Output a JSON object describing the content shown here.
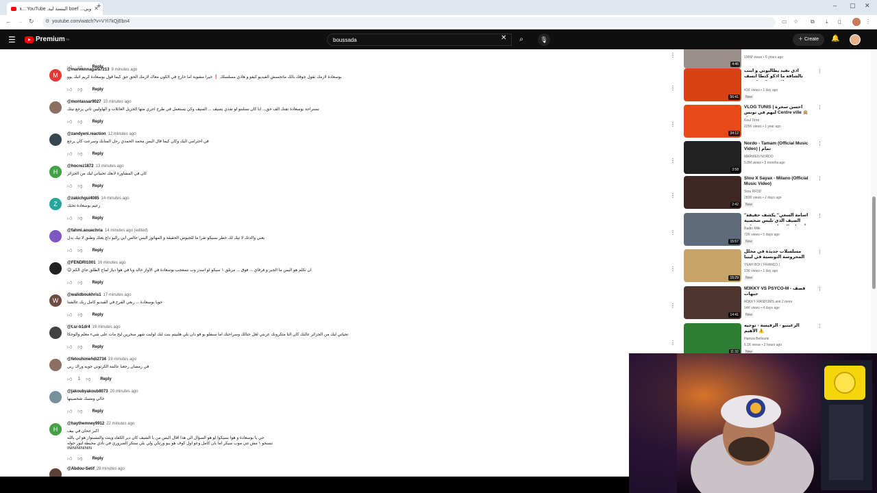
{
  "browser": {
    "tab_title": "وبي... boef البنسة ليه. ba... YouTube",
    "url": "youtube.com/watch?v=VYi7kQjEbn4",
    "new_tab": "+"
  },
  "header": {
    "logo_text": "Premium",
    "logo_tm": "TN",
    "search_value": "boussada",
    "create_label": "Create"
  },
  "comments": [
    {
      "user": "",
      "time": "",
      "text": "",
      "likes": "",
      "reply": "Reply",
      "avatar_letter": "",
      "avatar_color": "#ffffff"
    },
    {
      "user": "@marwennagara7213",
      "time": "9 minutes ago",
      "text": "بوسعادة لازمك تقول جوفك بالك ماتحسش الفيديو كيفو و هاذي مسلسلك ❗️ خيرا مشوية أما خارج في الكون معاك لازمك الحق حق كيما قول بوسعادة كريم اتبك يوو",
      "likes": "",
      "reply": "Reply",
      "avatar_letter": "M",
      "avatar_color": "#e53935"
    },
    {
      "user": "@montassar9027",
      "time": "10 minutes ago",
      "text": "تستراحة بوسعادة تفتك الف حق... انا كان تسلبتو لو تفذي بسيف ... السيف وكي يستعمل في طرح اجري منها الجزيل العائلات و الهاوليين تاتي يرجع نيتك",
      "likes": "",
      "reply": "Reply",
      "avatar_letter": "",
      "avatar_color": "#8d6e63"
    },
    {
      "user": "@zandyeni.reaction",
      "time": "12 minutes ago",
      "text": "في احترامي اليك وكان كيما قال اليس محمد الحمدي رحل المتابك وسرعت كان يرجع",
      "likes": "",
      "reply": "Reply",
      "avatar_letter": "",
      "avatar_color": "#37474f"
    },
    {
      "user": "@hocrez1872",
      "time": "13 minutes ago",
      "text": "كان في المشاورة لانعك تحبياتي ليك من الجزائر",
      "likes": "",
      "reply": "Reply",
      "avatar_letter": "H",
      "avatar_color": "#43a047"
    },
    {
      "user": "@zakichgui4085",
      "time": "14 minutes ago",
      "text": "زعيم بوسعادة نحبك",
      "likes": "",
      "reply": "Reply",
      "avatar_letter": "Z",
      "avatar_color": "#26a69a"
    },
    {
      "user": "@fahmi.aouachria",
      "time": "14 minutes ago (edited)",
      "text": "يعني والدتك لا تيك لك خطر بسيكو تقرا ما للجيوش الحقيقة و المهاتور اليس جالس أبي راليو داع يعتك وطبق لا تيك بدل",
      "likes": "",
      "reply": "Reply",
      "avatar_letter": "",
      "avatar_color": "#7e57c2"
    },
    {
      "user": "@FENDRI1001",
      "time": "16 minutes ago",
      "text": "😉 ان نكلم هو اليس ما الجبر و فرقاي ... فوق ... مرتلق ١ سيكو لو اسدر وب نتمعجب بوسعادة في الأواز خالد وبا في هوا دبار لماح الطلق جاي الكم",
      "likes": "",
      "reply": "Reply",
      "avatar_letter": "",
      "avatar_color": "#212121"
    },
    {
      "user": "@walidboukhris1",
      "time": "17 minutes ago",
      "text": "خويا بوسعادة ... ربعي الفرح في الفيديو كامل ربك عالشتا",
      "likes": "",
      "reply": "Reply",
      "avatar_letter": "W",
      "avatar_color": "#6d4c41"
    },
    {
      "user": "@t.sr-b1dr4",
      "time": "19 minutes ago",
      "text": "تحياتي ليك من الجزائر عالبك كان التا متكرونك عربتي لغل حتالك وسراحتك اما سبقلو بو فو دان بلي هلبيتم بنت لبك لولبت شهر سخرين ليخ مات على شيء معلم والوحكا",
      "likes": "",
      "reply": "Reply",
      "avatar_letter": "",
      "avatar_color": "#424242"
    },
    {
      "user": "@fetouhimehdi2734",
      "time": "19 minutes ago",
      "text": "في رمضان رجعنا عالمة الكرتوني جويه وراك ربي",
      "likes": "1",
      "reply": "Reply",
      "avatar_letter": "",
      "avatar_color": "#8d6e63"
    },
    {
      "user": "@jakoubyakoub8073",
      "time": "20 minutes ago",
      "text": "خالي ومسك شخصيتها",
      "likes": "",
      "reply": "Reply",
      "avatar_letter": "",
      "avatar_color": "#78909c"
    },
    {
      "user": "@haythemney9912",
      "time": "22 minutes ago",
      "text": "اكبر جحان في بيف",
      "text2": "حي يا بوسعادة و هوا بسيكوا لو هو السؤال الي هذا اقال اليس من با الشيف كان دير الكفاد وينت والمستواز هو لي بالله",
      "text3": "ننسحو ١ مش تتي موب سيكر اما بان كامل وعو اول كوف هو يبو ورتكي ولي بلي سنكر الصروري في نادي محيطة لتور جوله",
      "text4": "ININININININ",
      "likes": "",
      "reply": "Reply",
      "avatar_letter": "H",
      "avatar_color": "#43a047"
    },
    {
      "user": "@Abdou-Setif",
      "time": "28 minutes ago",
      "text": "",
      "likes": "",
      "reply": "",
      "avatar_letter": "",
      "avatar_color": "#5d4037"
    }
  ],
  "sidebar": [
    {
      "title": "",
      "channel": "",
      "meta": "196M views • 6 years ago",
      "duration": "4:46",
      "new": "",
      "thumb_color": "#9a8f8a"
    },
    {
      "title": "اذي نفيد يطاليوني و ابنت بالشافة ما اذكو كتطا اتسف علات بدو كور كوينت",
      "channel": "",
      "meta": "41K views • 1 day ago",
      "duration": "56:41",
      "new": "New",
      "thumb_color": "#d84315"
    },
    {
      "title": "VLOG TUNIS | احسن سخرة ليهم في تونس Centre ville 🙊 🙏",
      "channel": "Koul Time",
      "meta": "225K views • 1 year ago",
      "duration": "34:12",
      "new": "",
      "thumb_color": "#e64a19"
    },
    {
      "title": "Nordo - Tamam (Official Music Video) | تمام",
      "channel": "MARWEN NORDO",
      "meta": "5.8M views • 5 months ago",
      "duration": "3:58",
      "new": "",
      "thumb_color": "#212121"
    },
    {
      "title": "Stou X Sayax - Milano (Official Music Video)",
      "channel": "Stou RR3D",
      "meta": "283K views • 2 days ago",
      "duration": "2:42",
      "new": "New",
      "thumb_color": "#3e2723"
    },
    {
      "title": "\"أسامة السعي\" يكشف حقيقة الضيف الذي تلبس شخصية أصحاب الموتانيين في برنامج",
      "channel": "Radio Mtik",
      "meta": "72K views • 5 days ago",
      "duration": "15:57",
      "new": "New",
      "thumb_color": "#5d6b7a"
    },
    {
      "title": "مسلسلات جديدة في مخلل المحروسة التونسية في ليبيا",
      "channel": "YEAH BOI ( FRANCO )",
      "meta": "13K views • 1 day ago",
      "duration": "15:29",
      "new": "New",
      "thumb_color": "#c6a46a"
    },
    {
      "title": "M3KKY VS PSYCO-M - قصف جبهات",
      "channel": "M3KKY RANDOMS and 2 more",
      "meta": "14K views • 4 days ago",
      "duration": "14:41",
      "new": "New",
      "thumb_color": "#4e342e"
    },
    {
      "title": "الرغبنيو - الرفيسة - توجيه الأهيم ⚠️",
      "channel": "Hamza Belloumi",
      "meta": "6.1K views • 2 hours ago",
      "duration": "11:32",
      "new": "New",
      "thumb_color": "#2e7d32"
    }
  ],
  "colors": {
    "accent": "#ff0000",
    "header_bg": "#0f0f0f",
    "page_bg": "#ffffff"
  }
}
